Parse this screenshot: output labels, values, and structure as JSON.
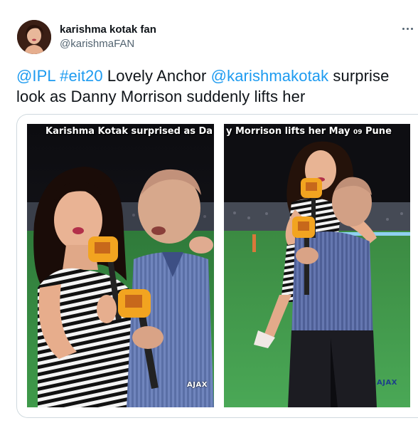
{
  "author": {
    "name": "karishma kotak fan",
    "handle": "@karishmaFAN"
  },
  "tweet": {
    "mention1": "@IPL",
    "hashtag": "#eit20",
    "text1": " Lovely Anchor ",
    "mention2": "@karishmakotak",
    "text2": " surprise look as Danny Morrison suddenly lifts her"
  },
  "media": {
    "caption_left": "Karishma Kotak surprised as Da",
    "caption_right_main": "y Morrison lifts her May ",
    "caption_right_small": "09",
    "caption_right_end": " Pune",
    "watermark_left": "AJAX",
    "watermark_right": "AJAX"
  },
  "icons": {
    "more": "more-horizontal-icon"
  },
  "colors": {
    "link": "#1d9bf0",
    "text": "#0f1419",
    "secondary": "#536471",
    "border": "#cfd9de"
  }
}
